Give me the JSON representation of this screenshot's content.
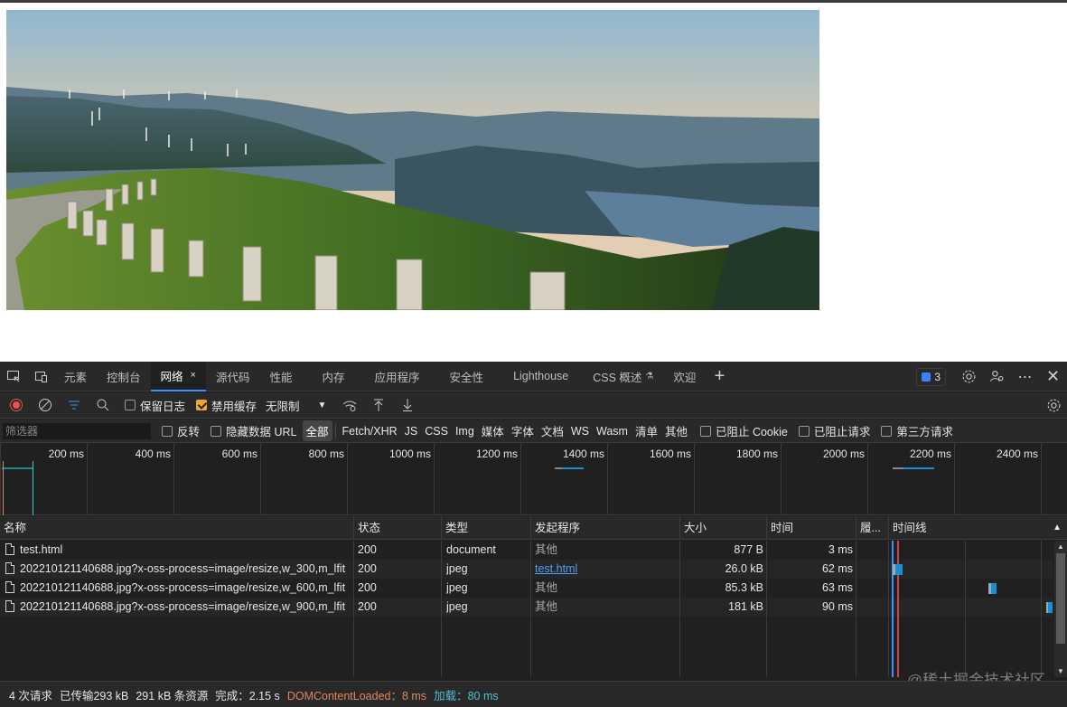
{
  "page": {
    "background": "#ffffff",
    "devtools_bg": "#202020"
  },
  "photo": {
    "description_icon": "landscape-image"
  },
  "tabs": [
    {
      "label": "元素",
      "active": false
    },
    {
      "label": "控制台",
      "active": false
    },
    {
      "label": "网络",
      "active": true,
      "close": "×"
    },
    {
      "label": "源代码",
      "active": false
    },
    {
      "label": "性能",
      "active": false
    },
    {
      "label": "内存",
      "active": false
    },
    {
      "label": "应用程序",
      "active": false
    },
    {
      "label": "安全性",
      "active": false
    },
    {
      "label": "Lighthouse",
      "active": false
    },
    {
      "label": "CSS 概述",
      "active": false
    },
    {
      "label": "欢迎",
      "active": false
    }
  ],
  "tabbar": {
    "plus": "+",
    "issues_count": "3",
    "icons": [
      "inspect-icon",
      "device-toggle-icon",
      "settings-icon",
      "customize-icon",
      "more-icon",
      "close-icon"
    ]
  },
  "toolbar": {
    "preserve_log": "保留日志",
    "disable_cache": "禁用缓存",
    "throttle": "无限制",
    "preserve_log_checked": false,
    "disable_cache_checked": true
  },
  "filterbar": {
    "placeholder": "筛选器",
    "invert": "反转",
    "hide_data_urls": "隐藏数据 URL",
    "types": [
      "全部",
      "Fetch/XHR",
      "JS",
      "CSS",
      "Img",
      "媒体",
      "字体",
      "文档",
      "WS",
      "Wasm",
      "清单",
      "其他"
    ],
    "selected_type": "全部",
    "blocked_cookies": "已阻止 Cookie",
    "blocked_requests": "已阻止请求",
    "third_party": "第三方请求"
  },
  "overview": {
    "ticks": [
      "200 ms",
      "400 ms",
      "600 ms",
      "800 ms",
      "1000 ms",
      "1200 ms",
      "1400 ms",
      "1600 ms",
      "1800 ms",
      "2000 ms",
      "2200 ms",
      "2400 ms"
    ]
  },
  "columns": {
    "name": "名称",
    "status": "状态",
    "type": "类型",
    "initiator": "发起程序",
    "size": "大小",
    "time": "时间",
    "priority": "履...",
    "waterfall": "时间线"
  },
  "rows": [
    {
      "name": "test.html",
      "status": "200",
      "type": "document",
      "initiator": "其他",
      "initiator_link": false,
      "size": "877 B",
      "time": "3 ms"
    },
    {
      "name": "202210121140688.jpg?x-oss-process=image/resize,w_300,m_lfit",
      "status": "200",
      "type": "jpeg",
      "initiator": "test.html",
      "initiator_link": true,
      "size": "26.0 kB",
      "time": "62 ms"
    },
    {
      "name": "202210121140688.jpg?x-oss-process=image/resize,w_600,m_lfit",
      "status": "200",
      "type": "jpeg",
      "initiator": "其他",
      "initiator_link": false,
      "size": "85.3 kB",
      "time": "63 ms"
    },
    {
      "name": "202210121140688.jpg?x-oss-process=image/resize,w_900,m_lfit",
      "status": "200",
      "type": "jpeg",
      "initiator": "其他",
      "initiator_link": false,
      "size": "181 kB",
      "time": "90 ms"
    }
  ],
  "status": {
    "requests": "4 次请求",
    "transferred": "已传输293 kB",
    "resources": "291 kB 条资源",
    "finish": "完成：2.15 s",
    "dcl": "DOMContentLoaded：8 ms",
    "load": "加载：80 ms"
  },
  "watermark": "@稀土掘金技术社区",
  "colors": {
    "accent": "#3794ff",
    "dcl": "#e3855a",
    "load": "#4fc1d6",
    "checkbox_on": "#f0a732",
    "link": "#4ea1f5"
  }
}
